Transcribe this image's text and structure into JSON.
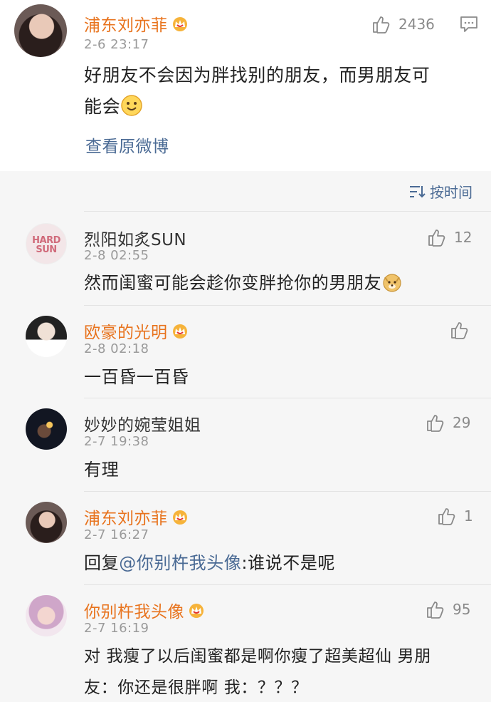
{
  "main_post": {
    "author": "浦东刘亦菲",
    "time": "2-6 23:17",
    "likes": "2436",
    "text_line1": "好朋友不会因为胖找别的朋友，而男朋友可",
    "text_line2": "能会",
    "view_original": "查看原微博"
  },
  "sort": {
    "label": "按时间"
  },
  "comments": [
    {
      "author": "烈阳如炙SUN",
      "time": "2-8 02:55",
      "likes": "12",
      "text": "然而闺蜜可能会趁你变胖抢你的男朋友",
      "avatar_text_1": "HARD",
      "avatar_text_2": "SUN"
    },
    {
      "author": "欧豪的光明",
      "time": "2-8 02:18",
      "likes": "",
      "text": "一百昏一百昏"
    },
    {
      "author": "妙妙的婉莹姐姐",
      "time": "2-7 19:38",
      "likes": "29",
      "text": "有理"
    },
    {
      "author": "浦东刘亦菲",
      "time": "2-7 16:27",
      "likes": "1",
      "text_prefix": "回复",
      "mention": "@你别杵我头像",
      "text_suffix": ":谁说不是呢"
    },
    {
      "author": "你别杵我头像",
      "time": "2-7 16:19",
      "likes": "95",
      "text_line1": "对 我瘦了以后闺蜜都是啊你瘦了超美超仙 男朋",
      "text_line2": "友：你还是很胖啊  我：？？？"
    }
  ],
  "colors": {
    "vip_name": "#e8731d",
    "link": "#4a6a94",
    "meta": "#9a9a9a"
  },
  "icons": [
    "thumb-up-icon",
    "comment-icon",
    "vip-crown-icon",
    "sort-icon",
    "smile-emoji-icon",
    "doge-emoji-icon"
  ]
}
